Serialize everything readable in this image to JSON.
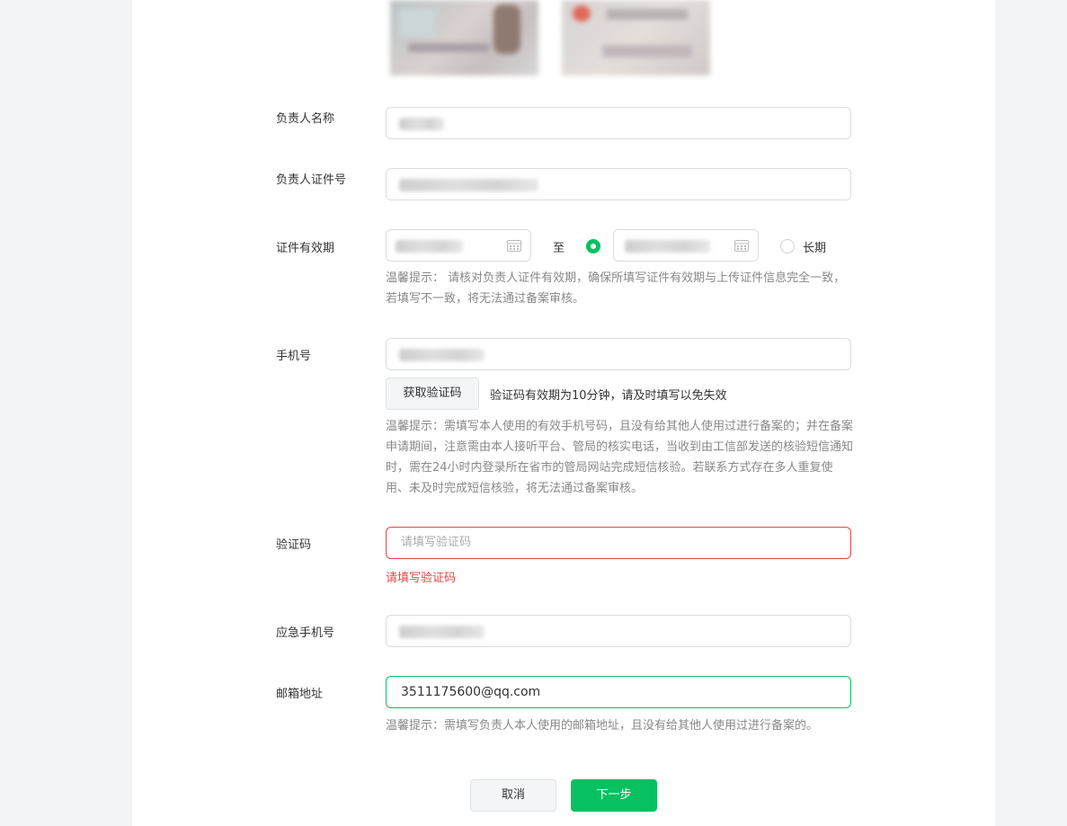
{
  "form": {
    "manager_name": {
      "label": "负责人名称"
    },
    "manager_id_number": {
      "label": "负责人证件号"
    },
    "id_validity": {
      "label": "证件有效期",
      "to_text": "至",
      "long_term_label": "长期",
      "hint": "温馨提示： 请核对负责人证件有效期，确保所填写证件有效期与上传证件信息完全一致，若填写不一致，将无法通过备案审核。"
    },
    "phone": {
      "label": "手机号",
      "get_code_button": "获取验证码",
      "code_validity_note": "验证码有效期为10分钟，请及时填写以免失效",
      "hint": "温馨提示：需填写本人使用的有效手机号码，且没有给其他人使用过进行备案的；并在备案申请期间，注意需由本人接听平台、管局的核实电话，当收到由工信部发送的核验短信通知时，需在24小时内登录所在省市的管局网站完成短信核验。若联系方式存在多人重复使用、未及时完成短信核验，将无法通过备案审核。"
    },
    "verification_code": {
      "label": "验证码",
      "placeholder": "请填写验证码",
      "error": "请填写验证码"
    },
    "emergency_phone": {
      "label": "应急手机号"
    },
    "email": {
      "label": "邮箱地址",
      "value": "3511175600@qq.com",
      "hint": "温馨提示：需填写负责人本人使用的邮箱地址，且没有给其他人使用过进行备案的。"
    }
  },
  "actions": {
    "cancel": "取消",
    "next": "下一步"
  },
  "colors": {
    "accent": "#07c160",
    "error": "#e54545",
    "hint": "#888888",
    "border": "#dcdcdc"
  },
  "icons": {
    "date_picker": "calendar-icon",
    "radio_selected": "radio-checked-icon",
    "radio_unselected": "radio-unchecked-icon"
  }
}
